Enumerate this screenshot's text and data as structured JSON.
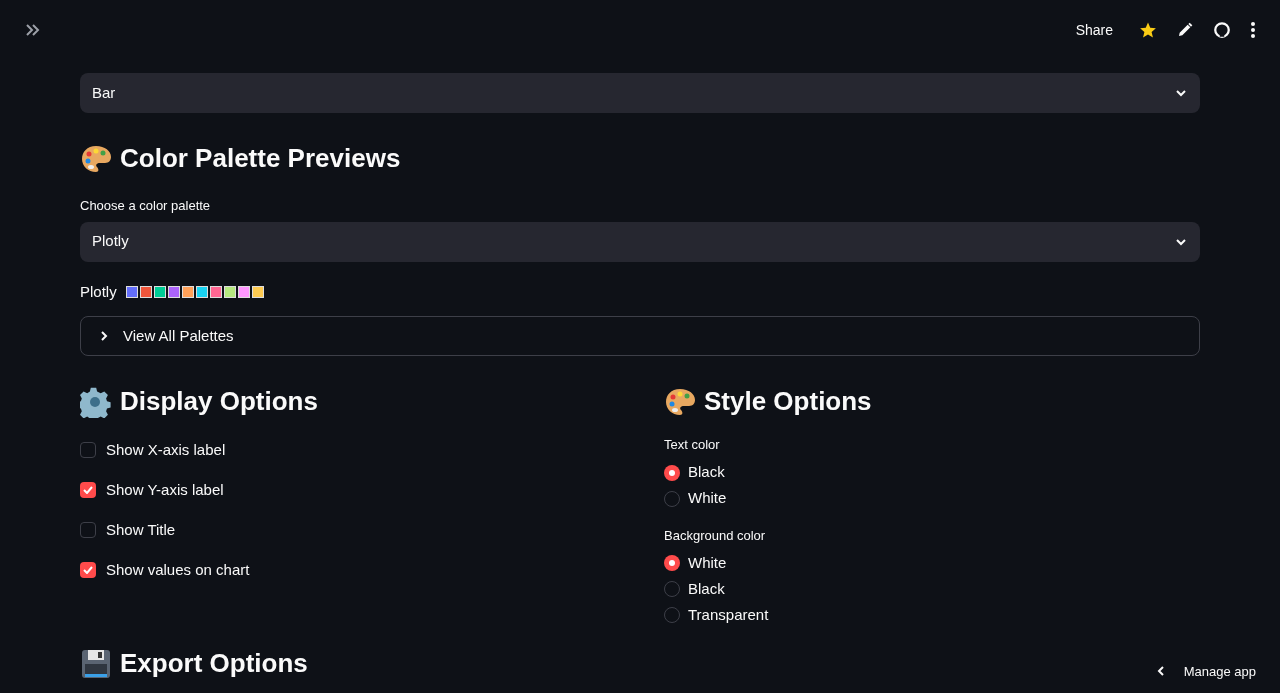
{
  "header": {
    "share": "Share"
  },
  "chart_type_select": {
    "value": "Bar"
  },
  "palette_section": {
    "title": "Color Palette Previews",
    "select": {
      "label": "Choose a color palette",
      "value": "Plotly"
    },
    "preview": {
      "name": "Plotly",
      "swatches": [
        {
          "color": "#636efa"
        },
        {
          "color": "#ef553b"
        },
        {
          "color": "#00cc96"
        },
        {
          "color": "#ab63fa"
        },
        {
          "color": "#ffa15a"
        },
        {
          "color": "#19d3f3"
        },
        {
          "color": "#ff6692"
        },
        {
          "color": "#b6e880"
        },
        {
          "color": "#ff97ff"
        },
        {
          "color": "#fecb52"
        }
      ]
    },
    "expander": {
      "label": "View All Palettes",
      "expanded": false
    }
  },
  "display_options": {
    "title": "Display Options",
    "checkboxes": [
      {
        "label": "Show X-axis label",
        "checked": false
      },
      {
        "label": "Show Y-axis label",
        "checked": true
      },
      {
        "label": "Show Title",
        "checked": false
      },
      {
        "label": "Show values on chart",
        "checked": true
      }
    ]
  },
  "style_options": {
    "title": "Style Options",
    "groups": [
      {
        "label": "Text color",
        "options": [
          {
            "label": "Black",
            "selected": true
          },
          {
            "label": "White",
            "selected": false
          }
        ]
      },
      {
        "label": "Background color",
        "options": [
          {
            "label": "White",
            "selected": true
          },
          {
            "label": "Black",
            "selected": false
          },
          {
            "label": "Transparent",
            "selected": false
          }
        ]
      }
    ]
  },
  "export_options": {
    "title": "Export Options"
  },
  "manage_app": "Manage app"
}
